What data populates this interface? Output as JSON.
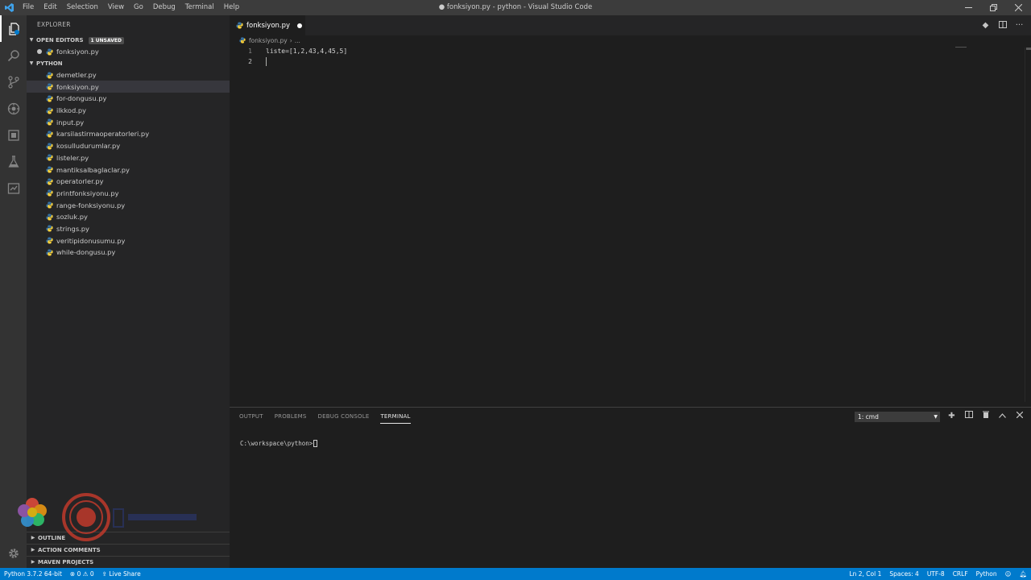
{
  "window": {
    "title": "● fonksiyon.py - python - Visual Studio Code",
    "menu": [
      "File",
      "Edit",
      "Selection",
      "View",
      "Go",
      "Debug",
      "Terminal",
      "Help"
    ]
  },
  "sidebar": {
    "header": "EXPLORER",
    "open_editors": {
      "label": "OPEN EDITORS",
      "badge": "1 UNSAVED",
      "files": [
        {
          "name": "fonksiyon.py",
          "unsaved": true
        }
      ]
    },
    "folder": {
      "label": "PYTHON",
      "files": [
        "demetler.py",
        "fonksiyon.py",
        "for-dongusu.py",
        "ilkkod.py",
        "input.py",
        "karsilastirmaoperatorleri.py",
        "kosulludurumlar.py",
        "listeler.py",
        "mantiksalbaglaclar.py",
        "operatorler.py",
        "printfonksiyonu.py",
        "range-fonksiyonu.py",
        "sozluk.py",
        "strings.py",
        "veritipidonusumu.py",
        "while-dongusu.py"
      ],
      "selected": "fonksiyon.py"
    },
    "bottom_sections": [
      "OUTLINE",
      "ACTION COMMENTS",
      "MAVEN PROJECTS"
    ]
  },
  "editor": {
    "tab_label": "fonksiyon.py",
    "breadcrumb": [
      "fonksiyon.py",
      "..."
    ],
    "lines": [
      {
        "number": "1",
        "text": "liste=[1,2,43,4,45,5]"
      },
      {
        "number": "2",
        "text": ""
      }
    ]
  },
  "panel": {
    "tabs": [
      "OUTPUT",
      "PROBLEMS",
      "DEBUG CONSOLE",
      "TERMINAL"
    ],
    "active_tab": "TERMINAL",
    "terminal_select": "1: cmd",
    "prompt": "C:\\workspace\\python>"
  },
  "statusbar": {
    "interpreter": "Python 3.7.2 64-bit",
    "errors": "0",
    "warnings": "0",
    "live_share": "Live Share",
    "position": "Ln 2, Col 1",
    "spaces": "Spaces: 4",
    "encoding": "UTF-8",
    "eol": "CRLF",
    "language": "Python"
  },
  "colors": {
    "statusbar": "#007acc",
    "editor_bg": "#1e1e1e",
    "sidebar_bg": "#252526",
    "activitybar_bg": "#333333",
    "python_blue": "#3572a5",
    "python_yellow": "#ffd43b"
  },
  "icons": {
    "activity": [
      "files-icon",
      "search-icon",
      "source-control-icon",
      "debug-icon",
      "extensions-icon",
      "test-icon",
      "remote-icon",
      "gear-icon"
    ]
  }
}
